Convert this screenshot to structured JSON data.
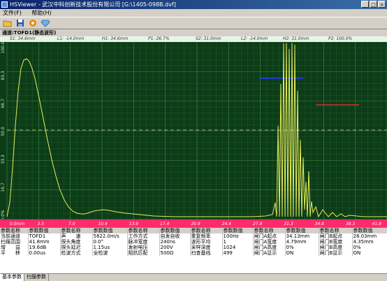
{
  "window": {
    "title": "HSViewer - 武汉中科创新技术股份有限公司 [G:\\1405-098B.dvf]"
  },
  "menu": [
    "文件(F)",
    "帮助(H)"
  ],
  "toolbar": {
    "icons": [
      "open-folder-icon",
      "save-disk-icon",
      "settings-gear-icon",
      "diamond-icon"
    ]
  },
  "channel": {
    "label": "通道:TOFD1(静态波形)"
  },
  "cursors": {
    "s1": "S1: 34.6mm",
    "l1": "L1: -14.0mm",
    "h1": "H1: 34.6mm",
    "p1": "P1: 26.7%",
    "s2": "S2: 31.0mm",
    "l2": "L2: -14.0mm",
    "h2": "H2: 31.0mm",
    "p2": "P2: 100.0%"
  },
  "chart_data": {
    "type": "line",
    "x_ticks": [
      "0.0mm",
      "3.5",
      "7.0",
      "10.4",
      "13.9",
      "17.4",
      "20.9",
      "24.4",
      "27.9",
      "31.3",
      "34.8",
      "38.3",
      "41.8"
    ],
    "y_ticks": [
      "100.0",
      "83.3",
      "66.7",
      "50.0",
      "33.3",
      "16.7",
      "0.0%"
    ],
    "xlim": [
      0,
      41.8
    ],
    "ylim": [
      0,
      100
    ],
    "grid": true,
    "colors": {
      "trace": "#e8ec5a",
      "grid": "#3f8a3f",
      "gate_blue": "#1e3cff",
      "gate_red": "#d83030",
      "midline": "#e8b0b0",
      "axis_band": "#ff2a6b"
    }
  },
  "params": {
    "headers": [
      "参数名称",
      "参数数值",
      "参数名称",
      "参数数值",
      "参数名称",
      "参数数值",
      "参数名称",
      "参数数值",
      "参数名称",
      "参数数值",
      "参数名称",
      "参数数值"
    ],
    "rows": [
      [
        "当前通道",
        "TOFD1",
        "声　　速",
        "5822.0m/s",
        "工作方式",
        "自发自收",
        "重复频率",
        "100Hz",
        "闸门A起点",
        "34.13mm",
        "闸门B起点",
        "28.03mm"
      ],
      [
        "扫描范围",
        "41.8mm",
        "探头角度",
        "0.0°",
        "脉冲宽度",
        "240ns",
        "波形平均",
        "1",
        "闸门A宽度",
        "4.79mm",
        "闸门B宽度",
        "4.35mm"
      ],
      [
        "增　　益",
        "19.6dB",
        "探头延迟",
        "1.15us",
        "发射电压",
        "200V",
        "采样深度",
        "1024",
        "闸门A高度",
        "0%",
        "闸门B高度",
        "0%"
      ],
      [
        "平　　移",
        "0.00us",
        "检波方式",
        "全检波",
        "阻抗匹配",
        "500Ω",
        "扫查基线",
        "499",
        "闸门A显示",
        "ON",
        "闸门B显示",
        "ON"
      ]
    ]
  },
  "tabs": [
    "基本参数",
    "扫描参数"
  ]
}
